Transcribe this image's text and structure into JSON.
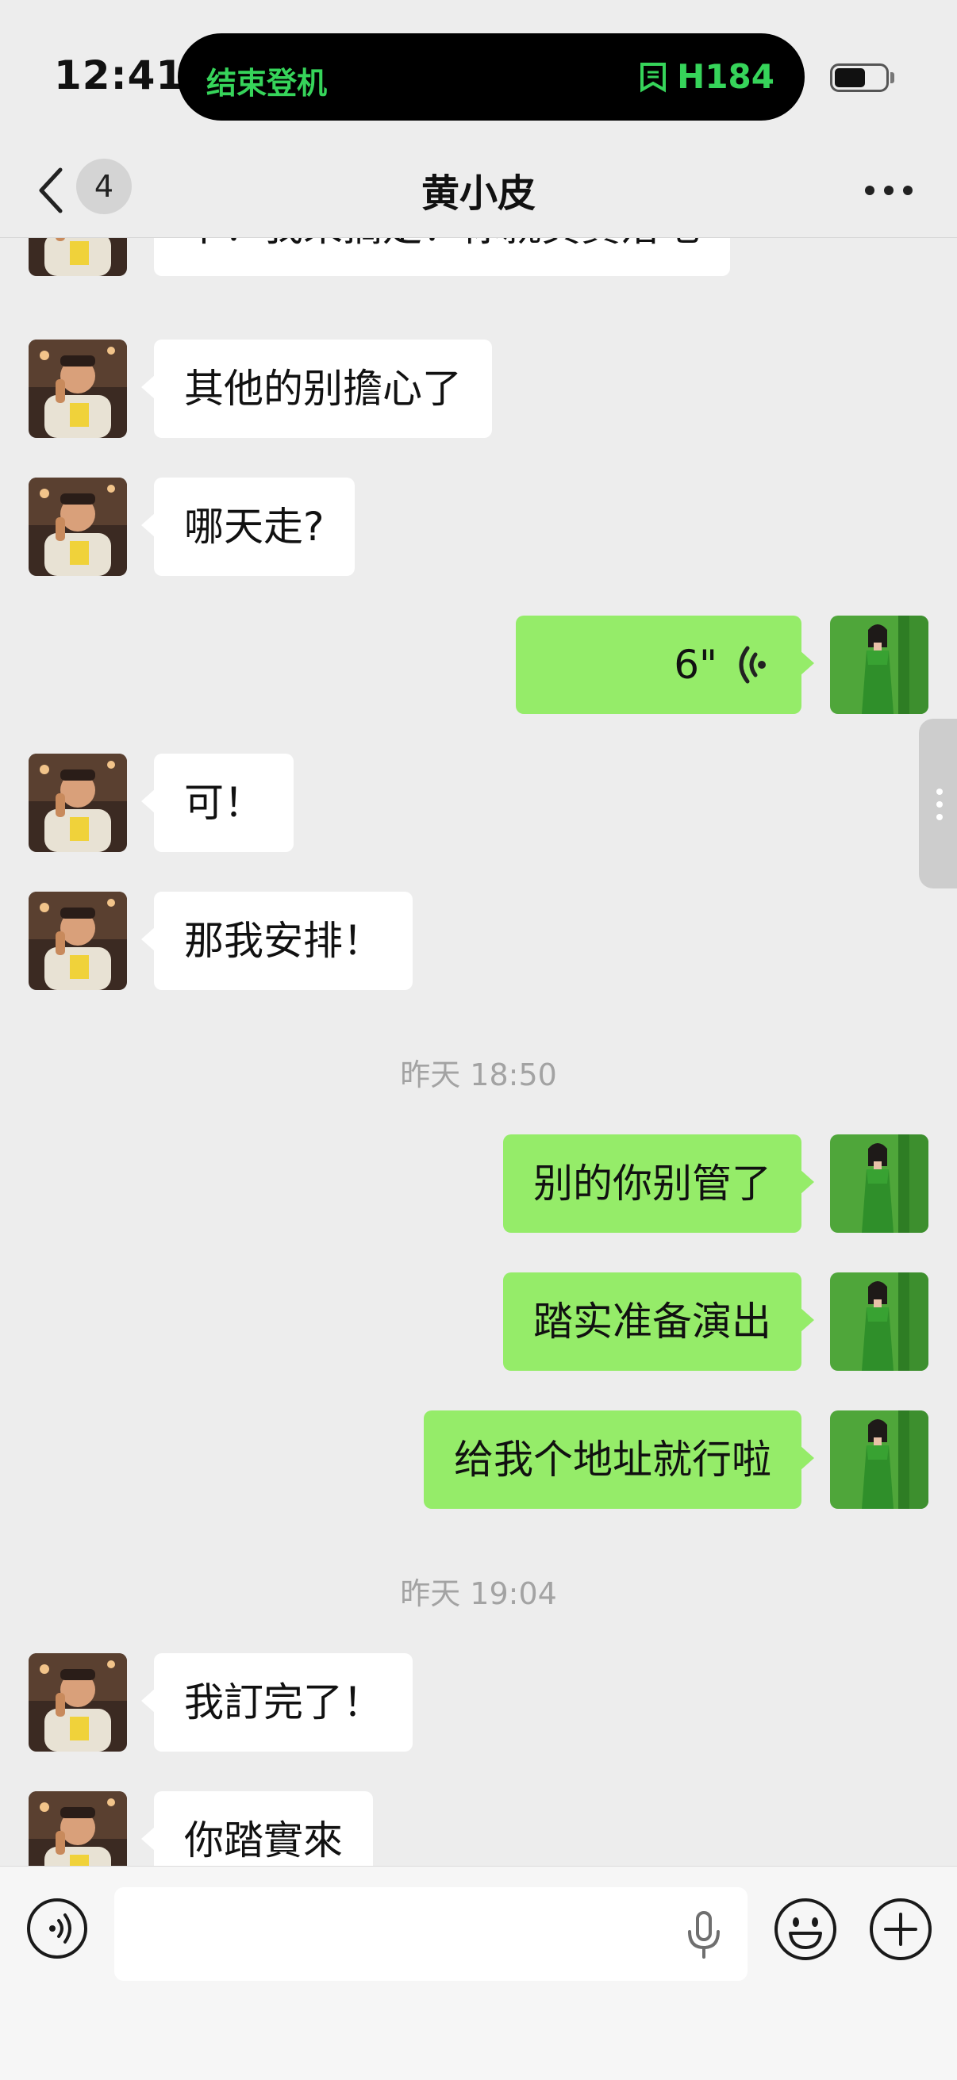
{
  "status_bar": {
    "time": "12:41",
    "island_left": "结束登机",
    "island_right": "H184",
    "accent_color": "#36d45a"
  },
  "nav": {
    "unread_count": "4",
    "title": "黄小皮"
  },
  "messages": [
    {
      "side": "left",
      "text": "不！我來搞定！你就負責落地"
    },
    {
      "side": "left",
      "text": "其他的别擔心了"
    },
    {
      "side": "left",
      "text": "哪天走?"
    },
    {
      "side": "right",
      "type": "voice",
      "text": "6\""
    },
    {
      "side": "left",
      "text": "可！"
    },
    {
      "side": "left",
      "text": "那我安排！"
    },
    {
      "type": "timestamp",
      "text": "昨天 18:50"
    },
    {
      "side": "right",
      "text": "别的你别管了"
    },
    {
      "side": "right",
      "text": "踏实准备演出"
    },
    {
      "side": "right",
      "text": "给我个地址就行啦"
    },
    {
      "type": "timestamp",
      "text": "昨天 19:04"
    },
    {
      "side": "left",
      "text": "我訂完了！"
    },
    {
      "side": "left",
      "text": "你踏實來"
    }
  ],
  "colors": {
    "own_bubble": "#95ec69",
    "other_bubble": "#ffffff",
    "background": "#ededed"
  },
  "icons": {
    "back": "chevron-left-icon",
    "more": "more-dots-icon",
    "voice_toggle": "voice-mode-icon",
    "mic": "microphone-icon",
    "emoji": "emoji-icon",
    "plus": "plus-icon"
  }
}
